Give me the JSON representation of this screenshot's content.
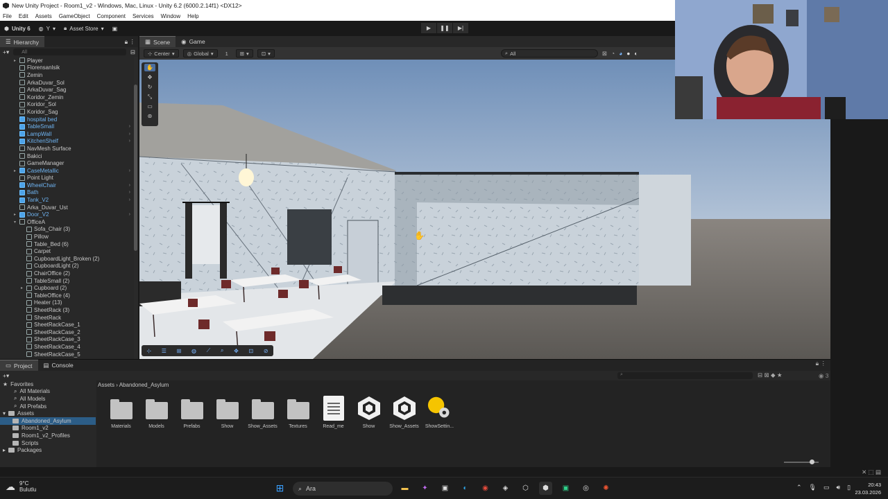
{
  "window": {
    "title": "New Unity Project - Room1_v2 - Windows, Mac, Linux - Unity 6.2 (6000.2.14f1) <DX12>"
  },
  "menu": [
    "File",
    "Edit",
    "Assets",
    "GameObject",
    "Component",
    "Services",
    "Window",
    "Help"
  ],
  "toolbar": {
    "unity_label": "Unity 6",
    "account_label": "Y",
    "asset_store_label": "Asset Store"
  },
  "hierarchy": {
    "tab_label": "Hierarchy",
    "search_placeholder": "All",
    "items": [
      {
        "label": "Player",
        "indent": 1,
        "prefab": false,
        "fold": "▸"
      },
      {
        "label": "Florensanlsik",
        "indent": 1,
        "prefab": false
      },
      {
        "label": "Zemin",
        "indent": 1,
        "prefab": false
      },
      {
        "label": "ArkaDuvar_Sol",
        "indent": 1,
        "prefab": false
      },
      {
        "label": "ArkaDuvar_Sag",
        "indent": 1,
        "prefab": false
      },
      {
        "label": "Koridor_Zemin",
        "indent": 1,
        "prefab": false
      },
      {
        "label": "Koridor_Sol",
        "indent": 1,
        "prefab": false
      },
      {
        "label": "Koridor_Sag",
        "indent": 1,
        "prefab": false
      },
      {
        "label": "hospital bed",
        "indent": 1,
        "prefab": true
      },
      {
        "label": "TableSmall",
        "indent": 1,
        "prefab": true,
        "arrow": true
      },
      {
        "label": "LampWall",
        "indent": 1,
        "prefab": true,
        "arrow": true
      },
      {
        "label": "KitchenShelf",
        "indent": 1,
        "prefab": true,
        "arrow": true
      },
      {
        "label": "NavMesh Surface",
        "indent": 1,
        "prefab": false
      },
      {
        "label": "Bakici",
        "indent": 1,
        "prefab": false
      },
      {
        "label": "GameManager",
        "indent": 1,
        "prefab": false
      },
      {
        "label": "CaseMetallic",
        "indent": 1,
        "prefab": true,
        "fold": "▸",
        "arrow": true
      },
      {
        "label": "Point Light",
        "indent": 1,
        "prefab": false
      },
      {
        "label": "WheelChair",
        "indent": 1,
        "prefab": true,
        "arrow": true
      },
      {
        "label": "Bath",
        "indent": 1,
        "prefab": true,
        "arrow": true
      },
      {
        "label": "Tank_V2",
        "indent": 1,
        "prefab": true,
        "arrow": true
      },
      {
        "label": "Arka_Duvar_Ust",
        "indent": 1,
        "prefab": false
      },
      {
        "label": "Door_V2",
        "indent": 1,
        "prefab": true,
        "fold": "▸",
        "arrow": true
      },
      {
        "label": "OfficeA",
        "indent": 1,
        "prefab": false,
        "fold": "▾"
      },
      {
        "label": "Sofa_Chair (3)",
        "indent": 2,
        "prefab": false
      },
      {
        "label": "Pillow",
        "indent": 2,
        "prefab": false
      },
      {
        "label": "Table_Bed (6)",
        "indent": 2,
        "prefab": false
      },
      {
        "label": "Carpet",
        "indent": 2,
        "prefab": false
      },
      {
        "label": "CupboardLight_Broken (2)",
        "indent": 2,
        "prefab": false
      },
      {
        "label": "CupboardLight (2)",
        "indent": 2,
        "prefab": false
      },
      {
        "label": "ChairOffice (2)",
        "indent": 2,
        "prefab": false
      },
      {
        "label": "TableSmall (2)",
        "indent": 2,
        "prefab": false
      },
      {
        "label": "Cupboard (2)",
        "indent": 2,
        "prefab": false,
        "fold": "▸"
      },
      {
        "label": "TableOffice (4)",
        "indent": 2,
        "prefab": false
      },
      {
        "label": "Heater (13)",
        "indent": 2,
        "prefab": false
      },
      {
        "label": "SheetRack (3)",
        "indent": 2,
        "prefab": false
      },
      {
        "label": "SheetRack",
        "indent": 2,
        "prefab": false
      },
      {
        "label": "SheetRackCase_1",
        "indent": 2,
        "prefab": false
      },
      {
        "label": "SheetRackCase_2",
        "indent": 2,
        "prefab": false
      },
      {
        "label": "SheetRackCase_3",
        "indent": 2,
        "prefab": false
      },
      {
        "label": "SheetRackCase_4",
        "indent": 2,
        "prefab": false
      },
      {
        "label": "SheetRackCase_5",
        "indent": 2,
        "prefab": false
      }
    ]
  },
  "scene": {
    "tabs": [
      "Scene",
      "Game"
    ],
    "pivot_label": "Center",
    "space_label": "Global",
    "grid_snap": "1",
    "search_placeholder": "All"
  },
  "project": {
    "tabs": [
      "Project",
      "Console"
    ],
    "breadcrumb_root": "Assets",
    "breadcrumb_current": "Abandoned_Asylum",
    "count": "3",
    "favorites_label": "Favorites",
    "favorites": [
      "All Materials",
      "All Models",
      "All Prefabs"
    ],
    "assets_label": "Assets",
    "tree": [
      {
        "label": "Abandoned_Asylum",
        "selected": true
      },
      {
        "label": "Room1_v2",
        "selected": false
      },
      {
        "label": "Room1_v2_Profiles",
        "selected": false
      },
      {
        "label": "Scripts",
        "selected": false
      }
    ],
    "packages_label": "Packages",
    "items": [
      {
        "name": "Materials",
        "kind": "folder"
      },
      {
        "name": "Models",
        "kind": "folder"
      },
      {
        "name": "Prefabs",
        "kind": "folder"
      },
      {
        "name": "Show",
        "kind": "folder"
      },
      {
        "name": "Show_Assets",
        "kind": "folder"
      },
      {
        "name": "Textures",
        "kind": "folder"
      },
      {
        "name": "Read_me",
        "kind": "doc"
      },
      {
        "name": "Show",
        "kind": "unity"
      },
      {
        "name": "Show_Assets",
        "kind": "unity"
      },
      {
        "name": "ShowSettin...",
        "kind": "settings"
      }
    ]
  },
  "taskbar": {
    "temperature": "9°C",
    "weather": "Bulutlu",
    "search_placeholder": "Ara",
    "time": "20:43",
    "date": "23.03.2026"
  },
  "colors": {
    "accent": "#4a6ea0",
    "prefab": "#6fb4f2",
    "selection": "#2c5d87",
    "sun": "#f5c400"
  }
}
